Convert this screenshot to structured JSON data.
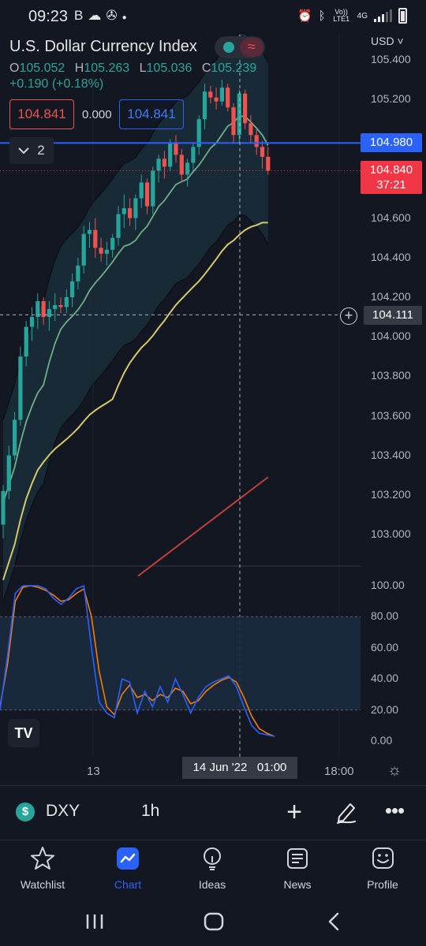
{
  "status_bar": {
    "time": "09:23",
    "left_icons": [
      "b-icon",
      "cloud-icon",
      "pinwheel-icon",
      "dot-icon"
    ],
    "right_icons": [
      "alarm-icon",
      "bluetooth-icon",
      "volte-icon",
      "4g-icon",
      "signal-icon",
      "battery-icon"
    ],
    "volte_label": "Vo)) LTE1",
    "network_label": "4G"
  },
  "header": {
    "title": "U.S. Dollar Currency Index",
    "open_label": "O",
    "open": "105.052",
    "high_label": "H",
    "high": "105.263",
    "low_label": "L",
    "low": "105.036",
    "close_label": "C",
    "close": "105.239",
    "change": "+0.190 (+0.18%)"
  },
  "trade": {
    "sell": "104.841",
    "spread": "0.000",
    "buy": "104.841",
    "collapse_count": "2"
  },
  "price_axis": {
    "currency": "USD",
    "ticks": [
      "105.400",
      "105.200",
      "104.600",
      "104.400",
      "104.200",
      "104.000",
      "103.800",
      "103.600",
      "103.400",
      "103.200",
      "103.000"
    ],
    "last_price_line": "104.980",
    "current_price": "104.840",
    "countdown": "37:21",
    "crosshair_price": "104.111"
  },
  "oscillator_axis": {
    "ticks": [
      "100.00",
      "80.00",
      "60.00",
      "40.00",
      "20.00",
      "0.00"
    ]
  },
  "time_axis": {
    "labels": [
      "13",
      "18:00"
    ],
    "crosshair_time": "14 Jun '22   01:00"
  },
  "toolbar": {
    "symbol": "DXY",
    "symbol_icon": "$",
    "interval": "1h"
  },
  "nav": {
    "items": [
      {
        "label": "Watchlist",
        "icon": "star-icon"
      },
      {
        "label": "Chart",
        "icon": "chart-icon"
      },
      {
        "label": "Ideas",
        "icon": "bulb-icon"
      },
      {
        "label": "News",
        "icon": "news-icon"
      },
      {
        "label": "Profile",
        "icon": "smiley-icon"
      }
    ],
    "active": "Chart"
  },
  "colors": {
    "background": "#131722",
    "up": "#26a69a",
    "down": "#ef5350",
    "accent": "#2962ff",
    "ma_short": "#6fae8a",
    "ma_mid": "#d6c867",
    "ma_long": "#c1403d",
    "stoch_k": "#2962ff",
    "stoch_d": "#f57c00"
  },
  "chart_data": {
    "type": "candlestick",
    "ohlc": [
      [
        103.05,
        103.25,
        102.98,
        103.22
      ],
      [
        103.22,
        103.45,
        103.18,
        103.4
      ],
      [
        103.4,
        103.62,
        103.38,
        103.58
      ],
      [
        103.58,
        103.95,
        103.55,
        103.9
      ],
      [
        103.9,
        104.08,
        103.85,
        104.05
      ],
      [
        104.05,
        104.15,
        103.98,
        104.1
      ],
      [
        104.1,
        104.22,
        104.04,
        104.18
      ],
      [
        104.18,
        104.2,
        104.06,
        104.1
      ],
      [
        104.1,
        104.18,
        104.03,
        104.14
      ],
      [
        104.14,
        104.22,
        104.08,
        104.16
      ],
      [
        104.16,
        104.2,
        104.12,
        104.15
      ],
      [
        104.15,
        104.24,
        104.12,
        104.2
      ],
      [
        104.2,
        104.32,
        104.15,
        104.28
      ],
      [
        104.28,
        104.4,
        104.24,
        104.36
      ],
      [
        104.36,
        104.56,
        104.32,
        104.52
      ],
      [
        104.52,
        104.58,
        104.45,
        104.54
      ],
      [
        104.54,
        104.6,
        104.4,
        104.45
      ],
      [
        104.45,
        104.5,
        104.38,
        104.42
      ],
      [
        104.42,
        104.48,
        104.36,
        104.44
      ],
      [
        104.44,
        104.52,
        104.4,
        104.5
      ],
      [
        104.5,
        104.66,
        104.46,
        104.62
      ],
      [
        104.62,
        104.72,
        104.55,
        104.65
      ],
      [
        104.65,
        104.7,
        104.56,
        104.6
      ],
      [
        104.6,
        104.72,
        104.54,
        104.7
      ],
      [
        104.7,
        104.82,
        104.65,
        104.78
      ],
      [
        104.78,
        104.8,
        104.62,
        104.66
      ],
      [
        104.66,
        104.86,
        104.62,
        104.84
      ],
      [
        104.84,
        104.92,
        104.78,
        104.9
      ],
      [
        104.9,
        104.94,
        104.8,
        104.86
      ],
      [
        104.86,
        105.0,
        104.84,
        104.98
      ],
      [
        104.98,
        105.02,
        104.88,
        104.92
      ],
      [
        104.92,
        104.95,
        104.78,
        104.82
      ],
      [
        104.82,
        104.9,
        104.76,
        104.88
      ],
      [
        104.88,
        104.98,
        104.84,
        104.96
      ],
      [
        104.96,
        105.12,
        104.92,
        105.1
      ],
      [
        105.1,
        105.28,
        105.05,
        105.24
      ],
      [
        105.24,
        105.27,
        105.18,
        105.21
      ],
      [
        105.21,
        105.26,
        105.15,
        105.19
      ],
      [
        105.19,
        105.3,
        105.17,
        105.26
      ],
      [
        105.26,
        105.28,
        105.14,
        105.16
      ],
      [
        105.16,
        105.18,
        104.98,
        105.02
      ],
      [
        105.02,
        105.25,
        104.98,
        105.23
      ],
      [
        105.23,
        105.25,
        105.05,
        105.08
      ],
      [
        105.08,
        105.12,
        104.98,
        105.02
      ],
      [
        105.02,
        105.05,
        104.92,
        104.96
      ],
      [
        104.96,
        104.99,
        104.85,
        104.91
      ],
      [
        104.91,
        104.96,
        104.82,
        104.84
      ]
    ],
    "stochastic": {
      "k": [
        20,
        55,
        95,
        100,
        100,
        100,
        98,
        92,
        88,
        92,
        98,
        100,
        60,
        25,
        18,
        15,
        40,
        38,
        18,
        32,
        22,
        35,
        25,
        40,
        30,
        18,
        28,
        35,
        38,
        40,
        42,
        35,
        22,
        10,
        5,
        4,
        3
      ],
      "d": [
        22,
        50,
        90,
        99,
        100,
        99,
        97,
        94,
        90,
        91,
        95,
        98,
        80,
        45,
        22,
        17,
        30,
        36,
        28,
        30,
        26,
        30,
        28,
        34,
        32,
        24,
        26,
        32,
        36,
        39,
        41,
        38,
        28,
        16,
        8,
        5,
        3
      ],
      "bands": [
        20,
        80
      ],
      "ylim": [
        0,
        100
      ]
    },
    "ylim": [
      102.8,
      105.45
    ]
  }
}
